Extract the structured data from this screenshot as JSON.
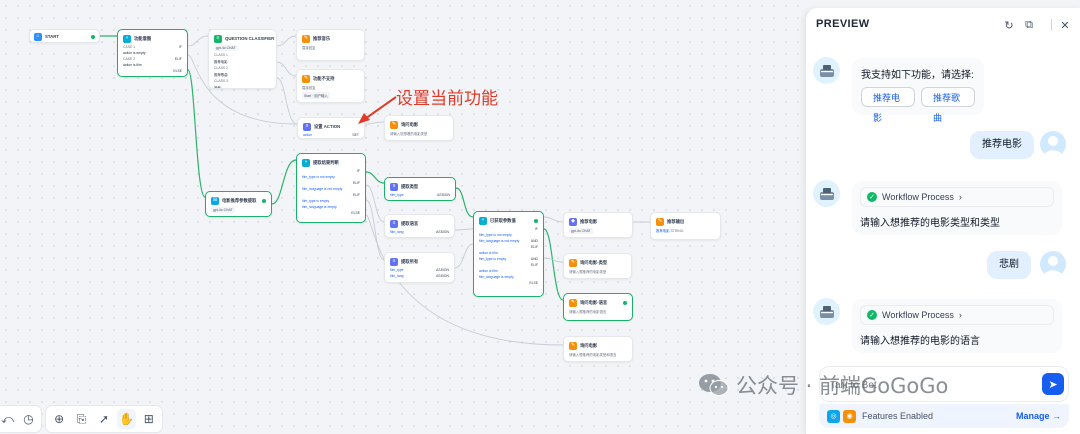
{
  "canvas": {
    "annotation": "设置当前功能",
    "nodes": {
      "start": {
        "title": "START"
      },
      "intent": {
        "title": "功能意图",
        "case1": "CASE 1",
        "case1_cond": "action is empty",
        "case2": "CASE 2",
        "case2_cond": "action is film",
        "else": "ELSE",
        "if_label": "IF",
        "elif_label": "ELIF"
      },
      "classifier": {
        "title": "QUESTION CLASSIFIER",
        "model": "gpt-4o",
        "tag": "CHAT",
        "class1": "CLASS 1",
        "class1_text": "推荐电影",
        "class2": "CLASS 2",
        "class2_text": "推荐歌曲",
        "class3": "CLASS 3",
        "class3_text": "其他"
      },
      "ans1": {
        "title": "推荐音乐",
        "sub": "直接回复"
      },
      "ans2": {
        "title": "功能不支持",
        "sub": "直接回复",
        "var": "Start",
        "var2": "用户输入"
      },
      "assign": {
        "title": "设置 ACTION",
        "var": "action",
        "tag": "SET"
      },
      "ans3": {
        "title": "询问电影",
        "sub": "请输入您想看的电影类型"
      },
      "film_cls": {
        "title": "电影推荐参数提取",
        "model": "gpt-4o",
        "tag": "CHAT"
      },
      "ifelse2": {
        "title": "提取结果判断",
        "c1": "film_type is not empty",
        "c2": "film_language is not empty",
        "c3": "film_type is empty",
        "c4": "film_language is empty",
        "if_label": "IF",
        "elif_label": "ELIF",
        "else": "ELSE",
        "and": "AND"
      },
      "ext1": {
        "title": "提取类型",
        "var": "film_type",
        "tag": "ASSIGN"
      },
      "ext2": {
        "title": "提取语言",
        "var": "film_lang",
        "tag": "ASSIGN"
      },
      "ext3": {
        "title": "提取所有",
        "var1": "film_type",
        "var2": "film_lang",
        "tag": "ASSIGN"
      },
      "ifelse3": {
        "title": "已获取参数值",
        "c1": "film_type is not empty",
        "c2": "film_language is not empty",
        "c3": "action is film",
        "c4": "film_type is empty",
        "c5": "action is film",
        "c6": "film_language is empty",
        "if_label": "IF",
        "elif_label": "ELIF",
        "else": "ELSE",
        "and": "AND"
      },
      "llm": {
        "title": "推荐电影",
        "model": "gpt-4o",
        "tag": "CHAT"
      },
      "out": {
        "title": "推荐输出",
        "var": "推荐电影",
        "tag": "STRING"
      },
      "ans4": {
        "title": "询问电影-类型",
        "sub": "请输入想推荐的电影类型"
      },
      "ans5": {
        "title": "询问电影-语言",
        "sub": "请输入想推荐的电影语言"
      },
      "ans6": {
        "title": "询问电影",
        "sub": "请输入想推荐的电影类型和语言"
      }
    }
  },
  "toolbar": {
    "icons": [
      "undo-icon",
      "history-icon",
      "add-node-icon",
      "note-icon",
      "pointer-icon",
      "hand-icon",
      "layout-icon"
    ]
  },
  "preview": {
    "title": "PREVIEW",
    "messages": [
      {
        "role": "bot",
        "text": "我支持如下功能，请选择:",
        "suggestions": [
          "推荐电影",
          "推荐歌曲"
        ]
      },
      {
        "role": "user",
        "text": "推荐电影"
      },
      {
        "role": "bot",
        "workflow": "Workflow Process",
        "text": "请输入想推荐的电影类型和类型"
      },
      {
        "role": "user",
        "text": "悲剧"
      },
      {
        "role": "bot",
        "workflow": "Workflow Process",
        "text": "请输入想推荐的电影的语言"
      }
    ],
    "input_placeholder": "Talk to Bot",
    "features_label": "Features Enabled",
    "manage_label": "Manage →"
  },
  "watermark": {
    "text": "公众号 · 前端GoGoGo"
  },
  "colors": {
    "accent": "#155eef",
    "success": "#12b76a",
    "annotation": "#e03a28"
  }
}
